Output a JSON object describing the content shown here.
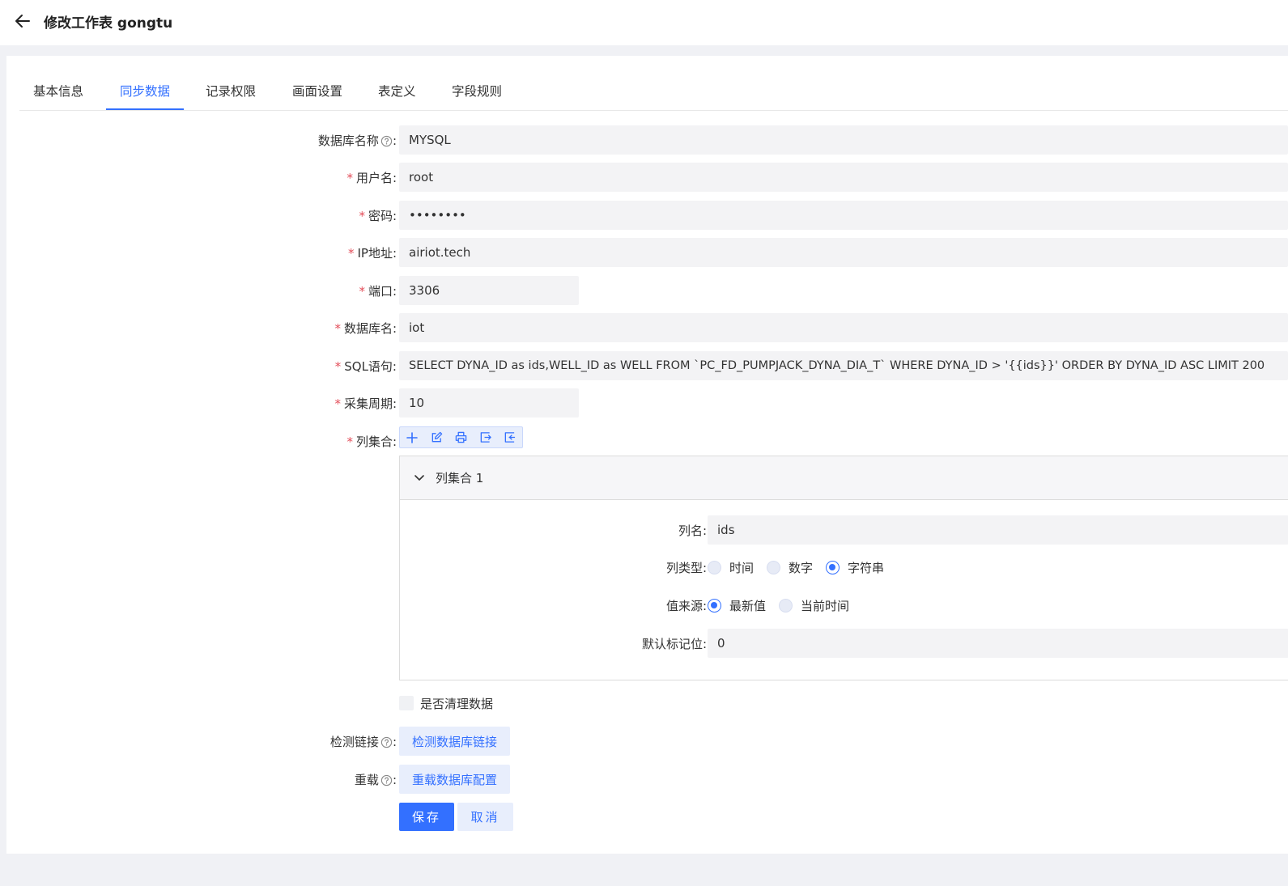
{
  "header": {
    "title": "修改工作表 gongtu"
  },
  "tabs": [
    {
      "label": "基本信息"
    },
    {
      "label": "同步数据"
    },
    {
      "label": "记录权限"
    },
    {
      "label": "画面设置"
    },
    {
      "label": "表定义"
    },
    {
      "label": "字段规则"
    }
  ],
  "active_tab": "同步数据",
  "form": {
    "db_type": {
      "label": "数据库名称",
      "value": "MYSQL"
    },
    "username": {
      "label": "用户名:",
      "value": "root"
    },
    "password": {
      "label": "密码:",
      "value": "••••••••"
    },
    "ip": {
      "label": "IP地址:",
      "value": "airiot.tech"
    },
    "port": {
      "label": "端口:",
      "value": "3306"
    },
    "db_name": {
      "label": "数据库名:",
      "value": "iot"
    },
    "sql": {
      "label": "SQL语句:",
      "value": "SELECT DYNA_ID as ids,WELL_ID as WELL FROM `PC_FD_PUMPJACK_DYNA_DIA_T` WHERE DYNA_ID > '{{ids}}' ORDER BY DYNA_ID ASC LIMIT 200"
    },
    "period": {
      "label": "采集周期:",
      "value": "10"
    },
    "columns": {
      "label": "列集合:"
    },
    "required_mark": "*",
    "colon": ":"
  },
  "column_set": {
    "title": "列集合 1",
    "col_name": {
      "label": "列名:",
      "value": "ids"
    },
    "col_type": {
      "label": "列类型:",
      "options": [
        "时间",
        "数字",
        "字符串"
      ],
      "selected": "字符串"
    },
    "value_source": {
      "label": "值来源:",
      "options": [
        "最新值",
        "当前时间"
      ],
      "selected": "最新值"
    },
    "default_flag": {
      "label": "默认标记位:",
      "value": "0"
    }
  },
  "clean_data": {
    "label": "是否清理数据",
    "checked": false
  },
  "check_link": {
    "label": "检测链接",
    "button": "检测数据库链接"
  },
  "reload": {
    "label": "重载",
    "button": "重载数据库配置"
  },
  "actions": {
    "save": "保存",
    "cancel": "取消"
  },
  "colors": {
    "accent": "#3370ff",
    "required": "#e34d59",
    "input_bg": "#f3f3f5"
  }
}
